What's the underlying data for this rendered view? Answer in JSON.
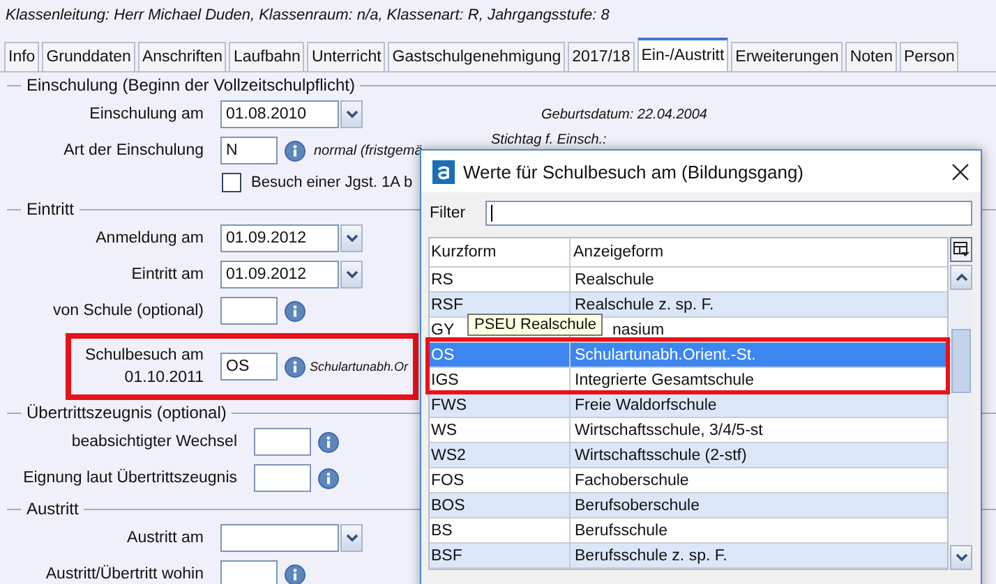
{
  "header": "Klassenleitung: Herr Michael Duden, Klassenraum: n/a, Klassenart: R, Jahrgangsstufe: 8",
  "tabs": [
    {
      "label": "Info",
      "selected": false
    },
    {
      "label": "Grunddaten",
      "selected": false
    },
    {
      "label": "Anschriften",
      "selected": false
    },
    {
      "label": "Laufbahn",
      "selected": false
    },
    {
      "label": "Unterricht",
      "selected": false
    },
    {
      "label": "Gastschulgenehmigung",
      "selected": false
    },
    {
      "label": "2017/18",
      "selected": false
    },
    {
      "label": "Ein-/Austritt",
      "selected": true
    },
    {
      "label": "Erweiterungen",
      "selected": false
    },
    {
      "label": "Noten",
      "selected": false
    },
    {
      "label": "Person",
      "selected": false
    }
  ],
  "sections": [
    {
      "title": "Einschulung (Beginn der Vollzeitschulpflicht)",
      "fields": [
        {
          "kind": "date",
          "label": "Einschulung am",
          "value": "01.08.2010",
          "note": "Geburtsdatum: 22.04.2004",
          "highlighted": false
        },
        {
          "kind": "code",
          "label": "Art der Einschulung",
          "value": "N",
          "note": "normal (fristgemä",
          "side_note": "Stichtag f. Einsch.:",
          "highlighted": false
        },
        {
          "kind": "checkbox",
          "label": "Besuch einer Jgst. 1A b",
          "checked": false
        }
      ]
    },
    {
      "title": "Eintritt",
      "fields": [
        {
          "kind": "date",
          "label": "Anmeldung am",
          "value": "01.09.2012",
          "highlighted": false
        },
        {
          "kind": "date",
          "label": "Eintritt am",
          "value": "01.09.2012",
          "highlighted": false
        },
        {
          "kind": "code",
          "label": "von Schule (optional)",
          "highlighted": false
        },
        {
          "kind": "code",
          "label": "Schulbesuch am",
          "date": "01.10.2011",
          "value": "OS",
          "note": "Schulartunabh.Or",
          "highlighted": true
        }
      ]
    },
    {
      "title": "Übertrittszeugnis (optional)",
      "fields": [
        {
          "kind": "code",
          "label": "beabsichtigter Wechsel",
          "highlighted": false
        },
        {
          "kind": "code",
          "label": "Eignung laut Übertrittszeugnis",
          "highlighted": false
        }
      ]
    },
    {
      "title": "Austritt",
      "fields": [
        {
          "kind": "date",
          "label": "Austritt am",
          "highlighted": false
        },
        {
          "kind": "code",
          "label": "Austritt/Übertritt wohin",
          "highlighted": false
        }
      ]
    }
  ],
  "dialog": {
    "title": "Werte für Schulbesuch am (Bildungsgang)",
    "filter_label": "Filter",
    "columns": [
      "Kurzform",
      "Anzeigeform"
    ],
    "tooltip": "PSEU Realschule",
    "rows": [
      {
        "code": "RS",
        "name": "Realschule",
        "selected": false,
        "highlighted": false
      },
      {
        "code": "RSF",
        "name": "Realschule z. sp. F.",
        "selected": false,
        "highlighted": false
      },
      {
        "code": "GY",
        "name": "nasium",
        "selected": false,
        "highlighted": false
      },
      {
        "code": "OS",
        "name": "Schulartunabh.Orient.-St.",
        "selected": true,
        "highlighted": true
      },
      {
        "code": "IGS",
        "name": "Integrierte Gesamtschule",
        "selected": false,
        "highlighted": true
      },
      {
        "code": "FWS",
        "name": "Freie Waldorfschule",
        "selected": false,
        "highlighted": false
      },
      {
        "code": "WS",
        "name": "Wirtschaftsschule, 3/4/5-st",
        "selected": false,
        "highlighted": false
      },
      {
        "code": "WS2",
        "name": "Wirtschaftsschule (2-stf)",
        "selected": false,
        "highlighted": false
      },
      {
        "code": "FOS",
        "name": "Fachoberschule",
        "selected": false,
        "highlighted": false
      },
      {
        "code": "BOS",
        "name": "Berufsoberschule",
        "selected": false,
        "highlighted": false
      },
      {
        "code": "BS",
        "name": "Berufsschule",
        "selected": false,
        "highlighted": false
      },
      {
        "code": "BSF",
        "name": "Berufsschule z. sp. F.",
        "selected": false,
        "highlighted": false
      }
    ]
  }
}
